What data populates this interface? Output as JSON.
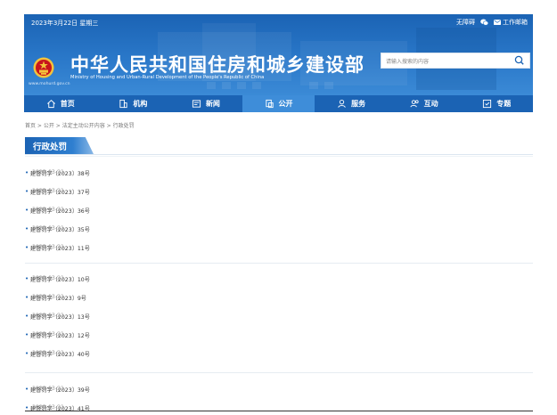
{
  "header": {
    "date": "2023年3月22日 星期三",
    "accessibility_label": "无障碍",
    "mail_label": "工作邮箱",
    "title": "中华人民共和国住房和城乡建设部",
    "subtitle": "Ministry of Housing and Urban-Rural Development of the People's Republic of China",
    "url": "www.mohurd.gov.cn",
    "search_placeholder": "请输入搜索的内容"
  },
  "nav": [
    {
      "label": "首页",
      "icon": "home-icon"
    },
    {
      "label": "机构",
      "icon": "building-icon"
    },
    {
      "label": "新闻",
      "icon": "news-icon"
    },
    {
      "label": "公开",
      "icon": "document-icon",
      "active": true
    },
    {
      "label": "服务",
      "icon": "user-service-icon"
    },
    {
      "label": "互动",
      "icon": "people-icon"
    },
    {
      "label": "专题",
      "icon": "topic-icon"
    }
  ],
  "breadcrumb": {
    "home": "首页",
    "sep": " > ",
    "public": "公开",
    "legal": "法定主动公开内容",
    "current": "行政处罚"
  },
  "section_title": "行政处罚",
  "items": [
    {
      "title": "建督罚字〔2023〕38号",
      "date": "2023-03-21"
    },
    {
      "title": "建督罚字〔2023〕37号",
      "date": "2023-03-21"
    },
    {
      "title": "建督罚字〔2023〕36号",
      "date": "2023-03-21"
    },
    {
      "title": "建督罚字〔2023〕35号",
      "date": "2023-03-21"
    },
    {
      "title": "建督罚字〔2023〕11号",
      "date": "2023-03-21"
    },
    {
      "title": "建督罚字〔2023〕10号",
      "date": "2023-03-21"
    },
    {
      "title": "建督罚字〔2023〕9号",
      "date": "2023-03-21"
    },
    {
      "title": "建督罚字〔2023〕13号",
      "date": "2023-03-21"
    },
    {
      "title": "建督罚字〔2023〕12号",
      "date": "2023-03-21"
    },
    {
      "title": "建督罚字〔2023〕40号",
      "date": "2023-03-21"
    },
    {
      "title": "建督罚字〔2023〕39号",
      "date": "2023-03-21"
    },
    {
      "title": "建督罚字〔2023〕41号",
      "date": "2023-03-21"
    }
  ],
  "colors": {
    "primary": "#1b63b4",
    "nav_active": "#3e8dd9",
    "accent_red": "#c8161d",
    "gold": "#f3c33b"
  }
}
